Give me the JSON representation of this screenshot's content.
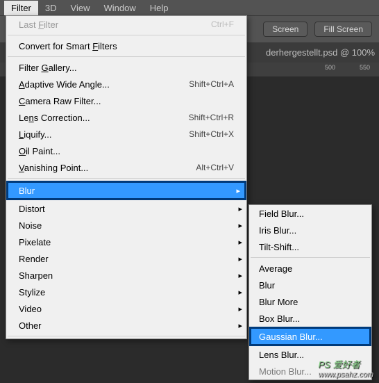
{
  "menubar": {
    "filter": "Filter",
    "threeD": "3D",
    "view": "View",
    "window": "Window",
    "help": "Help"
  },
  "toolbar": {
    "screen": "Screen",
    "fill_screen": "Fill Screen"
  },
  "document": {
    "tab_label": "derhergestellt.psd @ 100%"
  },
  "ruler": {
    "t1": "500",
    "t2": "550"
  },
  "filter_menu": {
    "last_filter": "Last Filter",
    "last_filter_shortcut": "Ctrl+F",
    "convert_smart": "Convert for Smart Filters",
    "gallery": "Filter Gallery...",
    "adaptive": "Adaptive Wide Angle...",
    "adaptive_shortcut": "Shift+Ctrl+A",
    "camera_raw": "Camera Raw Filter...",
    "lens_correction": "Lens Correction...",
    "lens_shortcut": "Shift+Ctrl+R",
    "liquify": "Liquify...",
    "liquify_shortcut": "Shift+Ctrl+X",
    "oil_paint": "Oil Paint...",
    "vanishing": "Vanishing Point...",
    "vanishing_shortcut": "Alt+Ctrl+V",
    "blur": "Blur",
    "distort": "Distort",
    "noise": "Noise",
    "pixelate": "Pixelate",
    "render": "Render",
    "sharpen": "Sharpen",
    "stylize": "Stylize",
    "video": "Video",
    "other": "Other"
  },
  "blur_submenu": {
    "field": "Field Blur...",
    "iris": "Iris Blur...",
    "tilt": "Tilt-Shift...",
    "average": "Average",
    "blur": "Blur",
    "blur_more": "Blur More",
    "box": "Box Blur...",
    "gaussian": "Gaussian Blur...",
    "lens": "Lens Blur...",
    "motion": "Motion Blur..."
  },
  "watermark": {
    "logo": "PS 爱好者",
    "url": "www.psahz.com"
  }
}
